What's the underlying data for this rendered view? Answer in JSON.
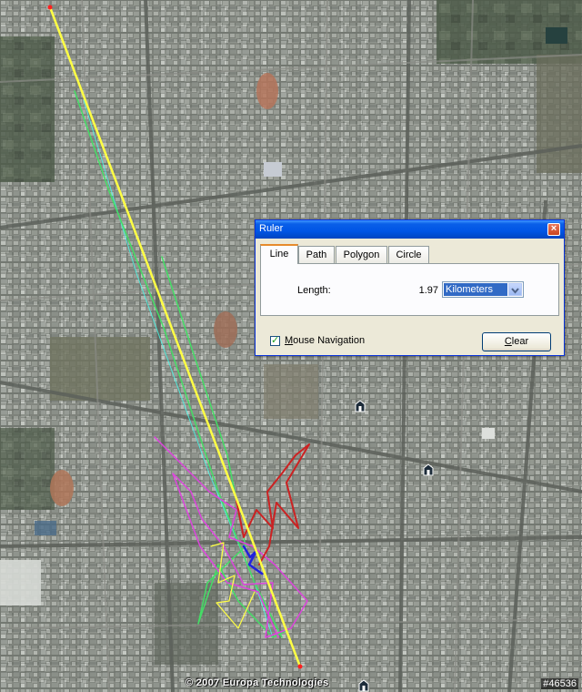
{
  "ruler": {
    "title": "Ruler",
    "close_glyph": "×",
    "tabs": [
      "Line",
      "Path",
      "Polygon",
      "Circle"
    ],
    "active_tab": "Line",
    "length_label": "Length:",
    "length_value": "1.97",
    "unit": "Kilometers",
    "mouse_navigation_label": "Mouse Navigation",
    "mouse_navigation_checked": true,
    "check_glyph": "✓",
    "clear_label": "Clear"
  },
  "map": {
    "copyright": "© 2007 Europa Technologies",
    "image_id": "#46536"
  },
  "colors": {
    "ruler_line": "#ffff44",
    "track_green": "#44dd66",
    "track_magenta": "#dd44dd",
    "track_red": "#cc2222",
    "track_cyan": "#44ffee",
    "track_blue": "#2222dd"
  },
  "icons": {
    "map_pins": [
      "building-pin-icon",
      "building-pin-icon",
      "building-pin-icon"
    ]
  }
}
